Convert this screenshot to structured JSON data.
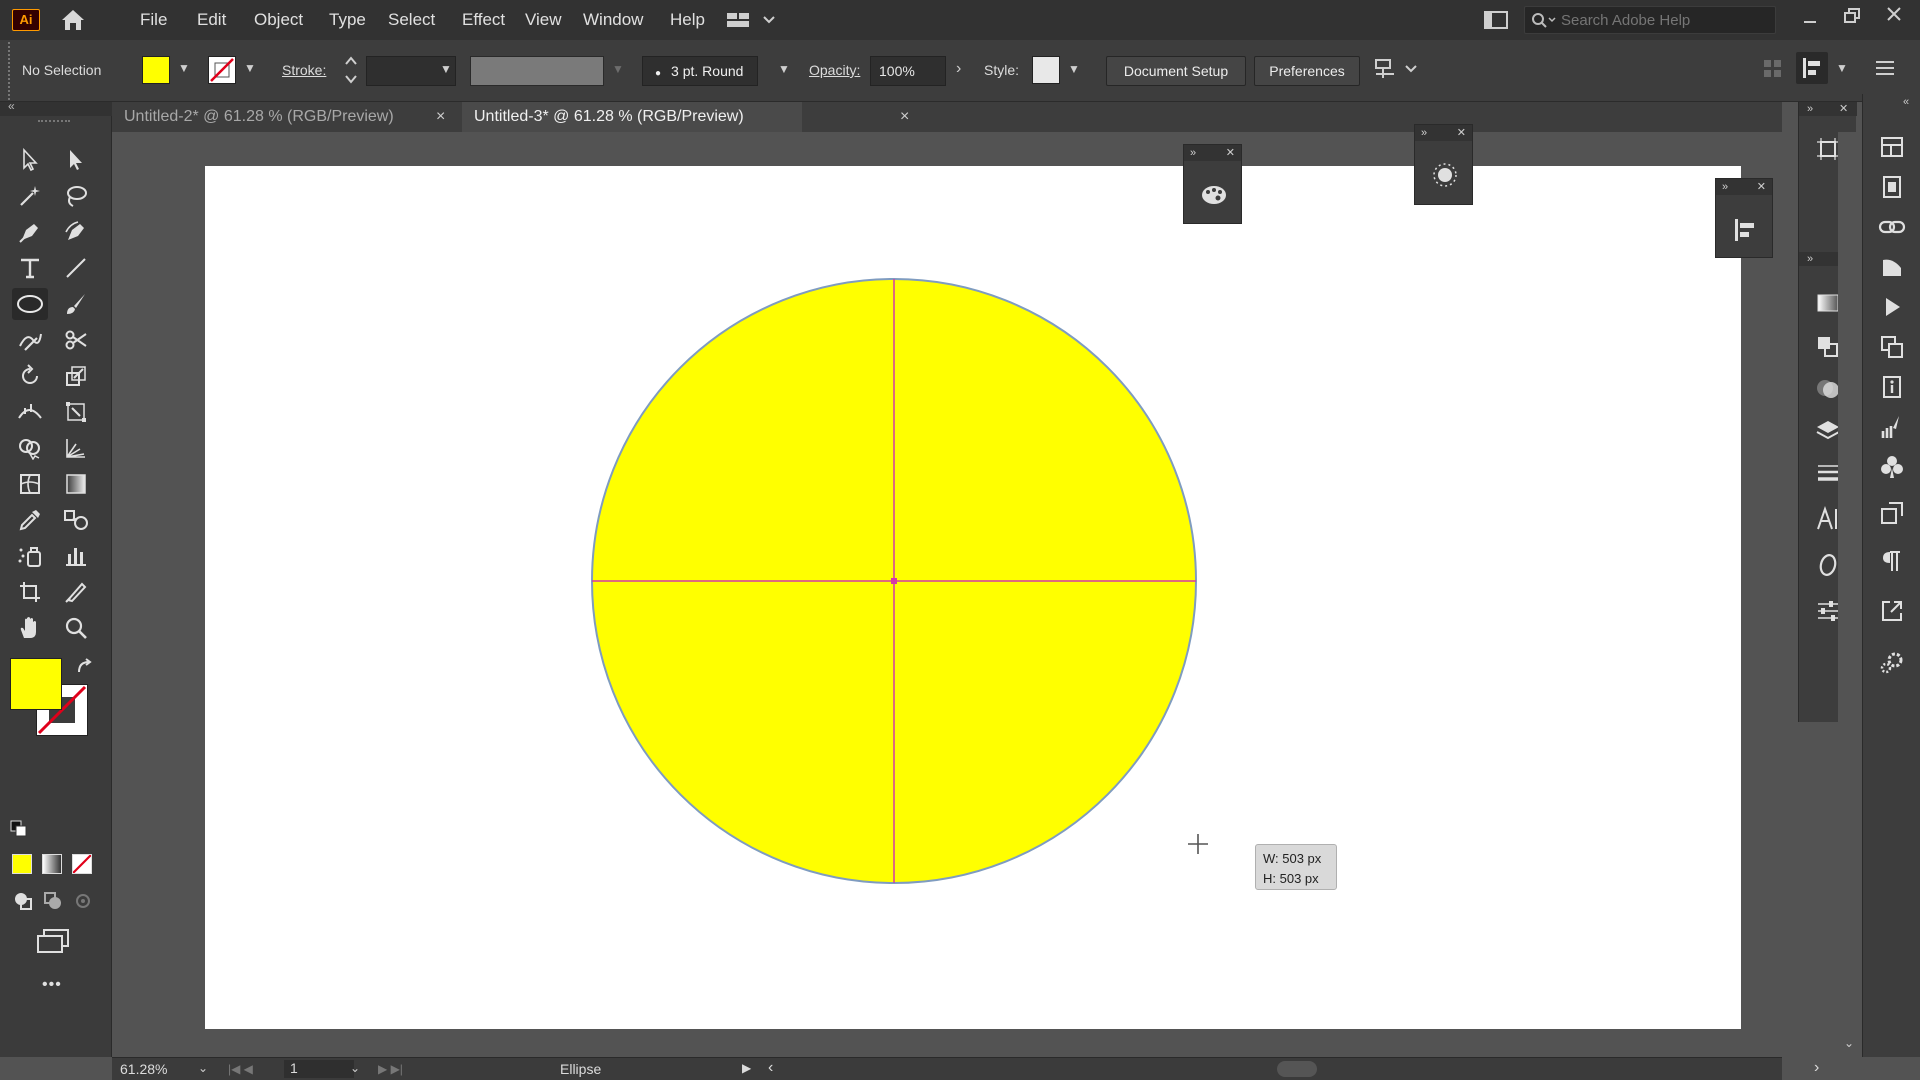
{
  "app": {
    "logo_text": "Ai"
  },
  "menu": {
    "items": [
      "File",
      "Edit",
      "Object",
      "Type",
      "Select",
      "Effect",
      "View",
      "Window",
      "Help"
    ],
    "search_placeholder": "Search Adobe Help"
  },
  "control_bar": {
    "selection_label": "No Selection",
    "fill_color": "#ffff00",
    "stroke_label": "Stroke:",
    "brush_label": "3 pt. Round",
    "opacity_label": "Opacity:",
    "opacity_value": "100%",
    "style_label": "Style:",
    "document_setup": "Document Setup",
    "preferences": "Preferences"
  },
  "tabs": [
    {
      "label": "Untitled-2* @ 61.28 % (RGB/Preview)",
      "close": "×",
      "active": false
    },
    {
      "label": "Untitled-3* @ 61.28 % (RGB/Preview)",
      "close": "×",
      "active": true
    }
  ],
  "toolbar": {
    "fill_color": "#ffff00",
    "more_label": "•••"
  },
  "canvas": {
    "shape_fill": "#ffff00",
    "guide_color": "#d43aa7",
    "tooltip": {
      "width": "W: 503 px",
      "height": "H: 503 px"
    }
  },
  "status_bar": {
    "zoom": "61.28%",
    "artboard_number": "1",
    "current_tool": "Ellipse"
  },
  "icons": {
    "top_right": [
      "minimize-icon",
      "restore-icon",
      "close-icon"
    ],
    "right_dock": [
      "libraries-icon",
      "properties-icon",
      "links-icon",
      "image-trace-icon",
      "actions-icon",
      "artboards-icon",
      "info-icon",
      "brushes-icon",
      "symbols-icon",
      "transform-icon",
      "paragraph-icon",
      "export-icon",
      "settings-icon"
    ]
  }
}
